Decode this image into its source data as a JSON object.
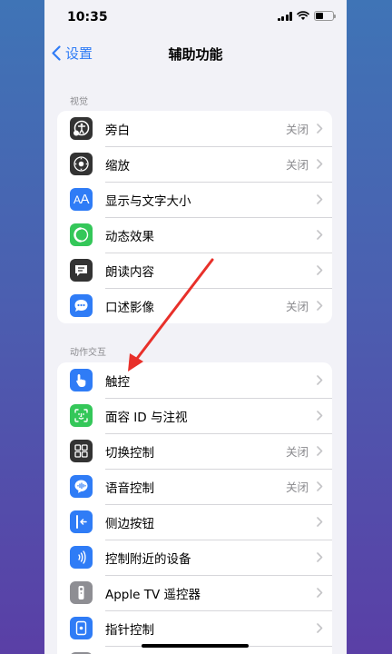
{
  "status": {
    "time": "10:35"
  },
  "nav": {
    "back_label": "设置",
    "title": "辅助功能"
  },
  "sections": [
    {
      "header": "视觉",
      "items": [
        {
          "label": "旁白",
          "value": "关闭",
          "icon": "voiceover-icon",
          "color": "#333333"
        },
        {
          "label": "缩放",
          "value": "关闭",
          "icon": "zoom-icon",
          "color": "#333333"
        },
        {
          "label": "显示与文字大小",
          "value": "",
          "icon": "text-size-icon",
          "color": "#2f7cf6"
        },
        {
          "label": "动态效果",
          "value": "",
          "icon": "motion-icon",
          "color": "#34c759"
        },
        {
          "label": "朗读内容",
          "value": "",
          "icon": "spoken-content-icon",
          "color": "#333333"
        },
        {
          "label": "口述影像",
          "value": "关闭",
          "icon": "audio-description-icon",
          "color": "#2f7cf6"
        }
      ]
    },
    {
      "header": "动作交互",
      "items": [
        {
          "label": "触控",
          "value": "",
          "icon": "touch-icon",
          "color": "#2f7cf6"
        },
        {
          "label": "面容 ID 与注视",
          "value": "",
          "icon": "face-id-icon",
          "color": "#34c759"
        },
        {
          "label": "切换控制",
          "value": "关闭",
          "icon": "switch-control-icon",
          "color": "#333333"
        },
        {
          "label": "语音控制",
          "value": "关闭",
          "icon": "voice-control-icon",
          "color": "#2f7cf6"
        },
        {
          "label": "侧边按钮",
          "value": "",
          "icon": "side-button-icon",
          "color": "#2f7cf6"
        },
        {
          "label": "控制附近的设备",
          "value": "",
          "icon": "nearby-devices-icon",
          "color": "#2f7cf6"
        },
        {
          "label": "Apple TV 遥控器",
          "value": "",
          "icon": "apple-tv-remote-icon",
          "color": "#8e8e93"
        },
        {
          "label": "指针控制",
          "value": "",
          "icon": "pointer-control-icon",
          "color": "#2f7cf6"
        }
      ]
    }
  ],
  "annotation": {
    "arrow_color": "#e8302a"
  }
}
